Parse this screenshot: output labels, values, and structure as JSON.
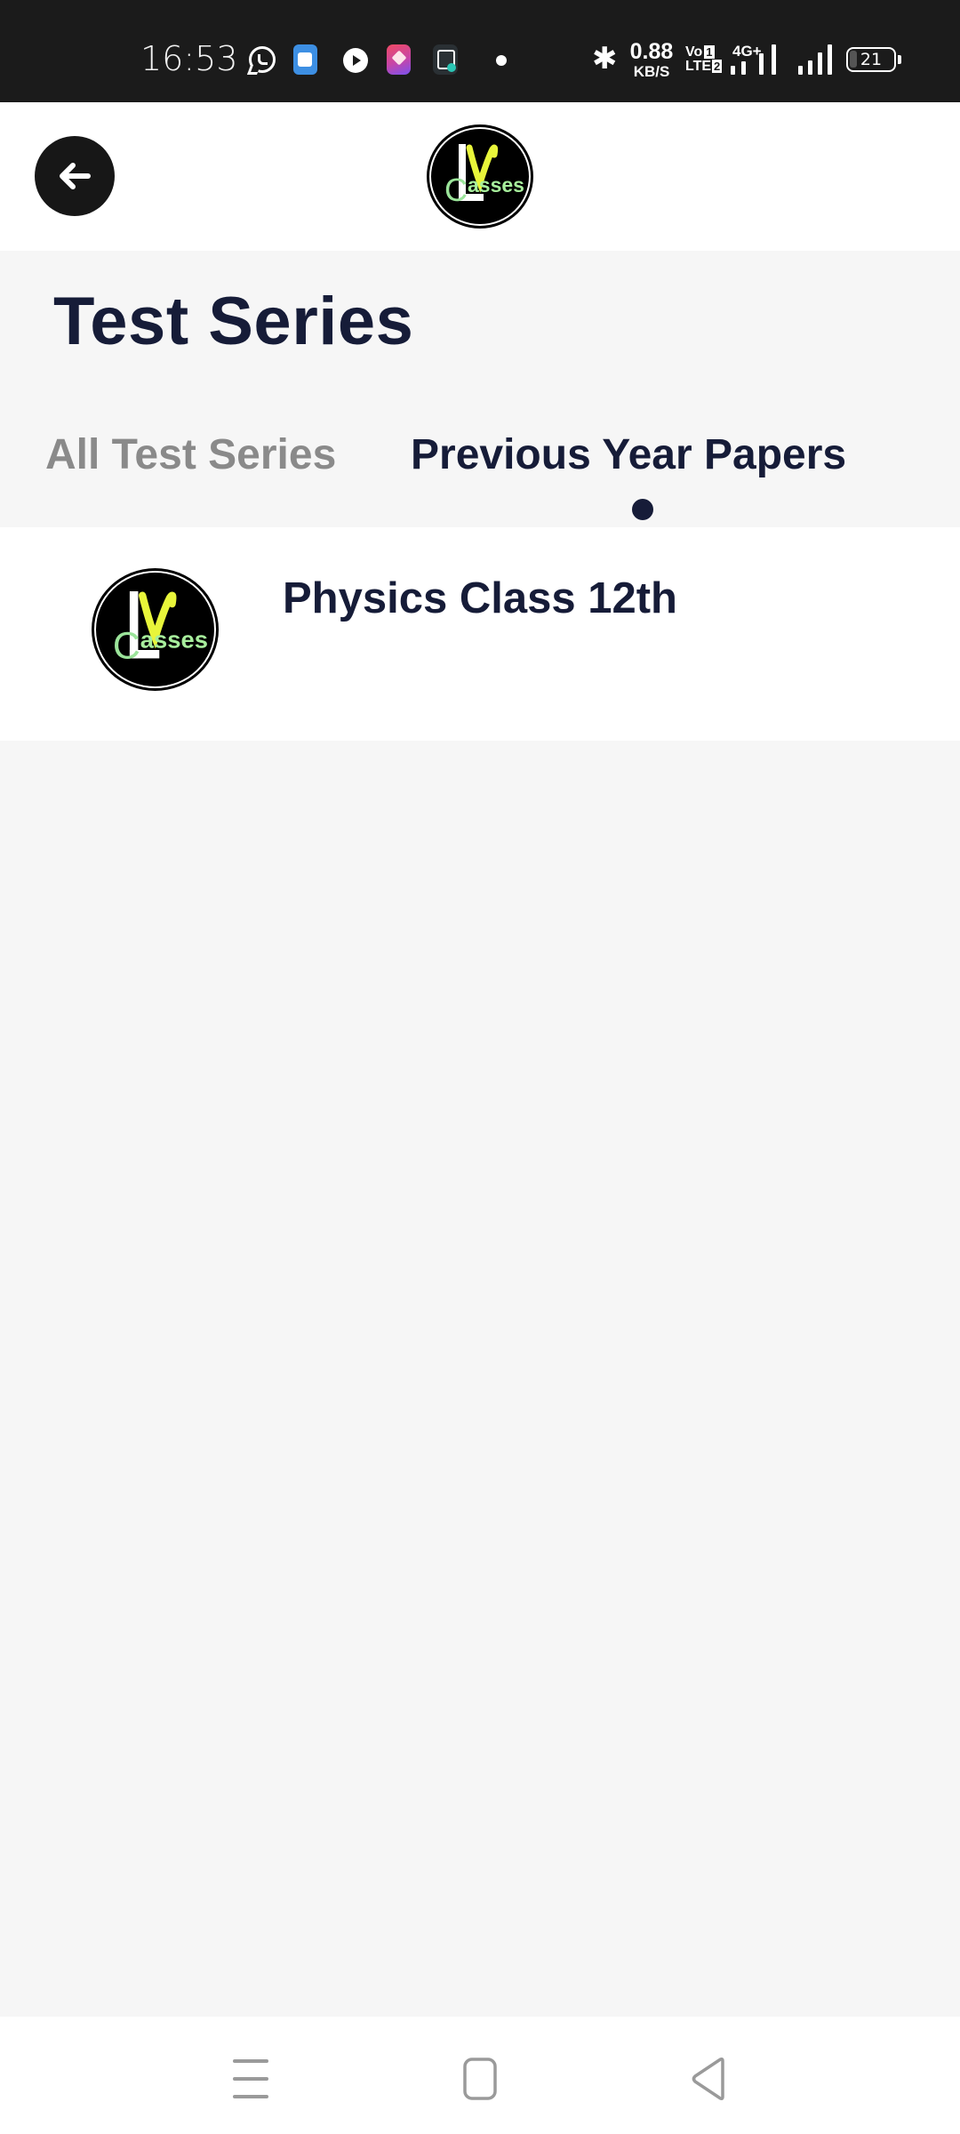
{
  "status_bar": {
    "time": "16:53",
    "notification_icons": [
      "whatsapp-icon",
      "messages-icon",
      "play-icon",
      "pinned-app-icon",
      "jiosaavn-icon",
      "more-notifications-dot"
    ],
    "bluetooth": "bluetooth-icon",
    "network_speed_value": "0.88",
    "network_speed_unit": "KB/S",
    "volte_line1": "Vo",
    "volte_line2": "LTE",
    "sim1_badge": "1",
    "sim2_badge": "2",
    "network_type": "4G+",
    "battery_level": "21"
  },
  "header": {
    "back_label": "Back",
    "logo_alt": "LV Classes",
    "logo_text": {
      "L": "L",
      "V": "V",
      "C": "C",
      "rest": "asses"
    }
  },
  "page": {
    "title": "Test Series",
    "tabs": [
      {
        "label": "All Test Series",
        "active": false
      },
      {
        "label": "Previous Year Papers",
        "active": true
      }
    ]
  },
  "series": [
    {
      "title": "Physics Class 12th",
      "logo_alt": "LV Classes"
    }
  ],
  "nav_bar": {
    "recents": "recents-button",
    "home": "home-button",
    "back": "back-button"
  },
  "colors": {
    "primary_text": "#161c38",
    "inactive_tab": "#8a8a8a",
    "background": "#f6f6f6",
    "logo_yellow": "#e8f53a",
    "logo_green": "#8fe08a"
  }
}
